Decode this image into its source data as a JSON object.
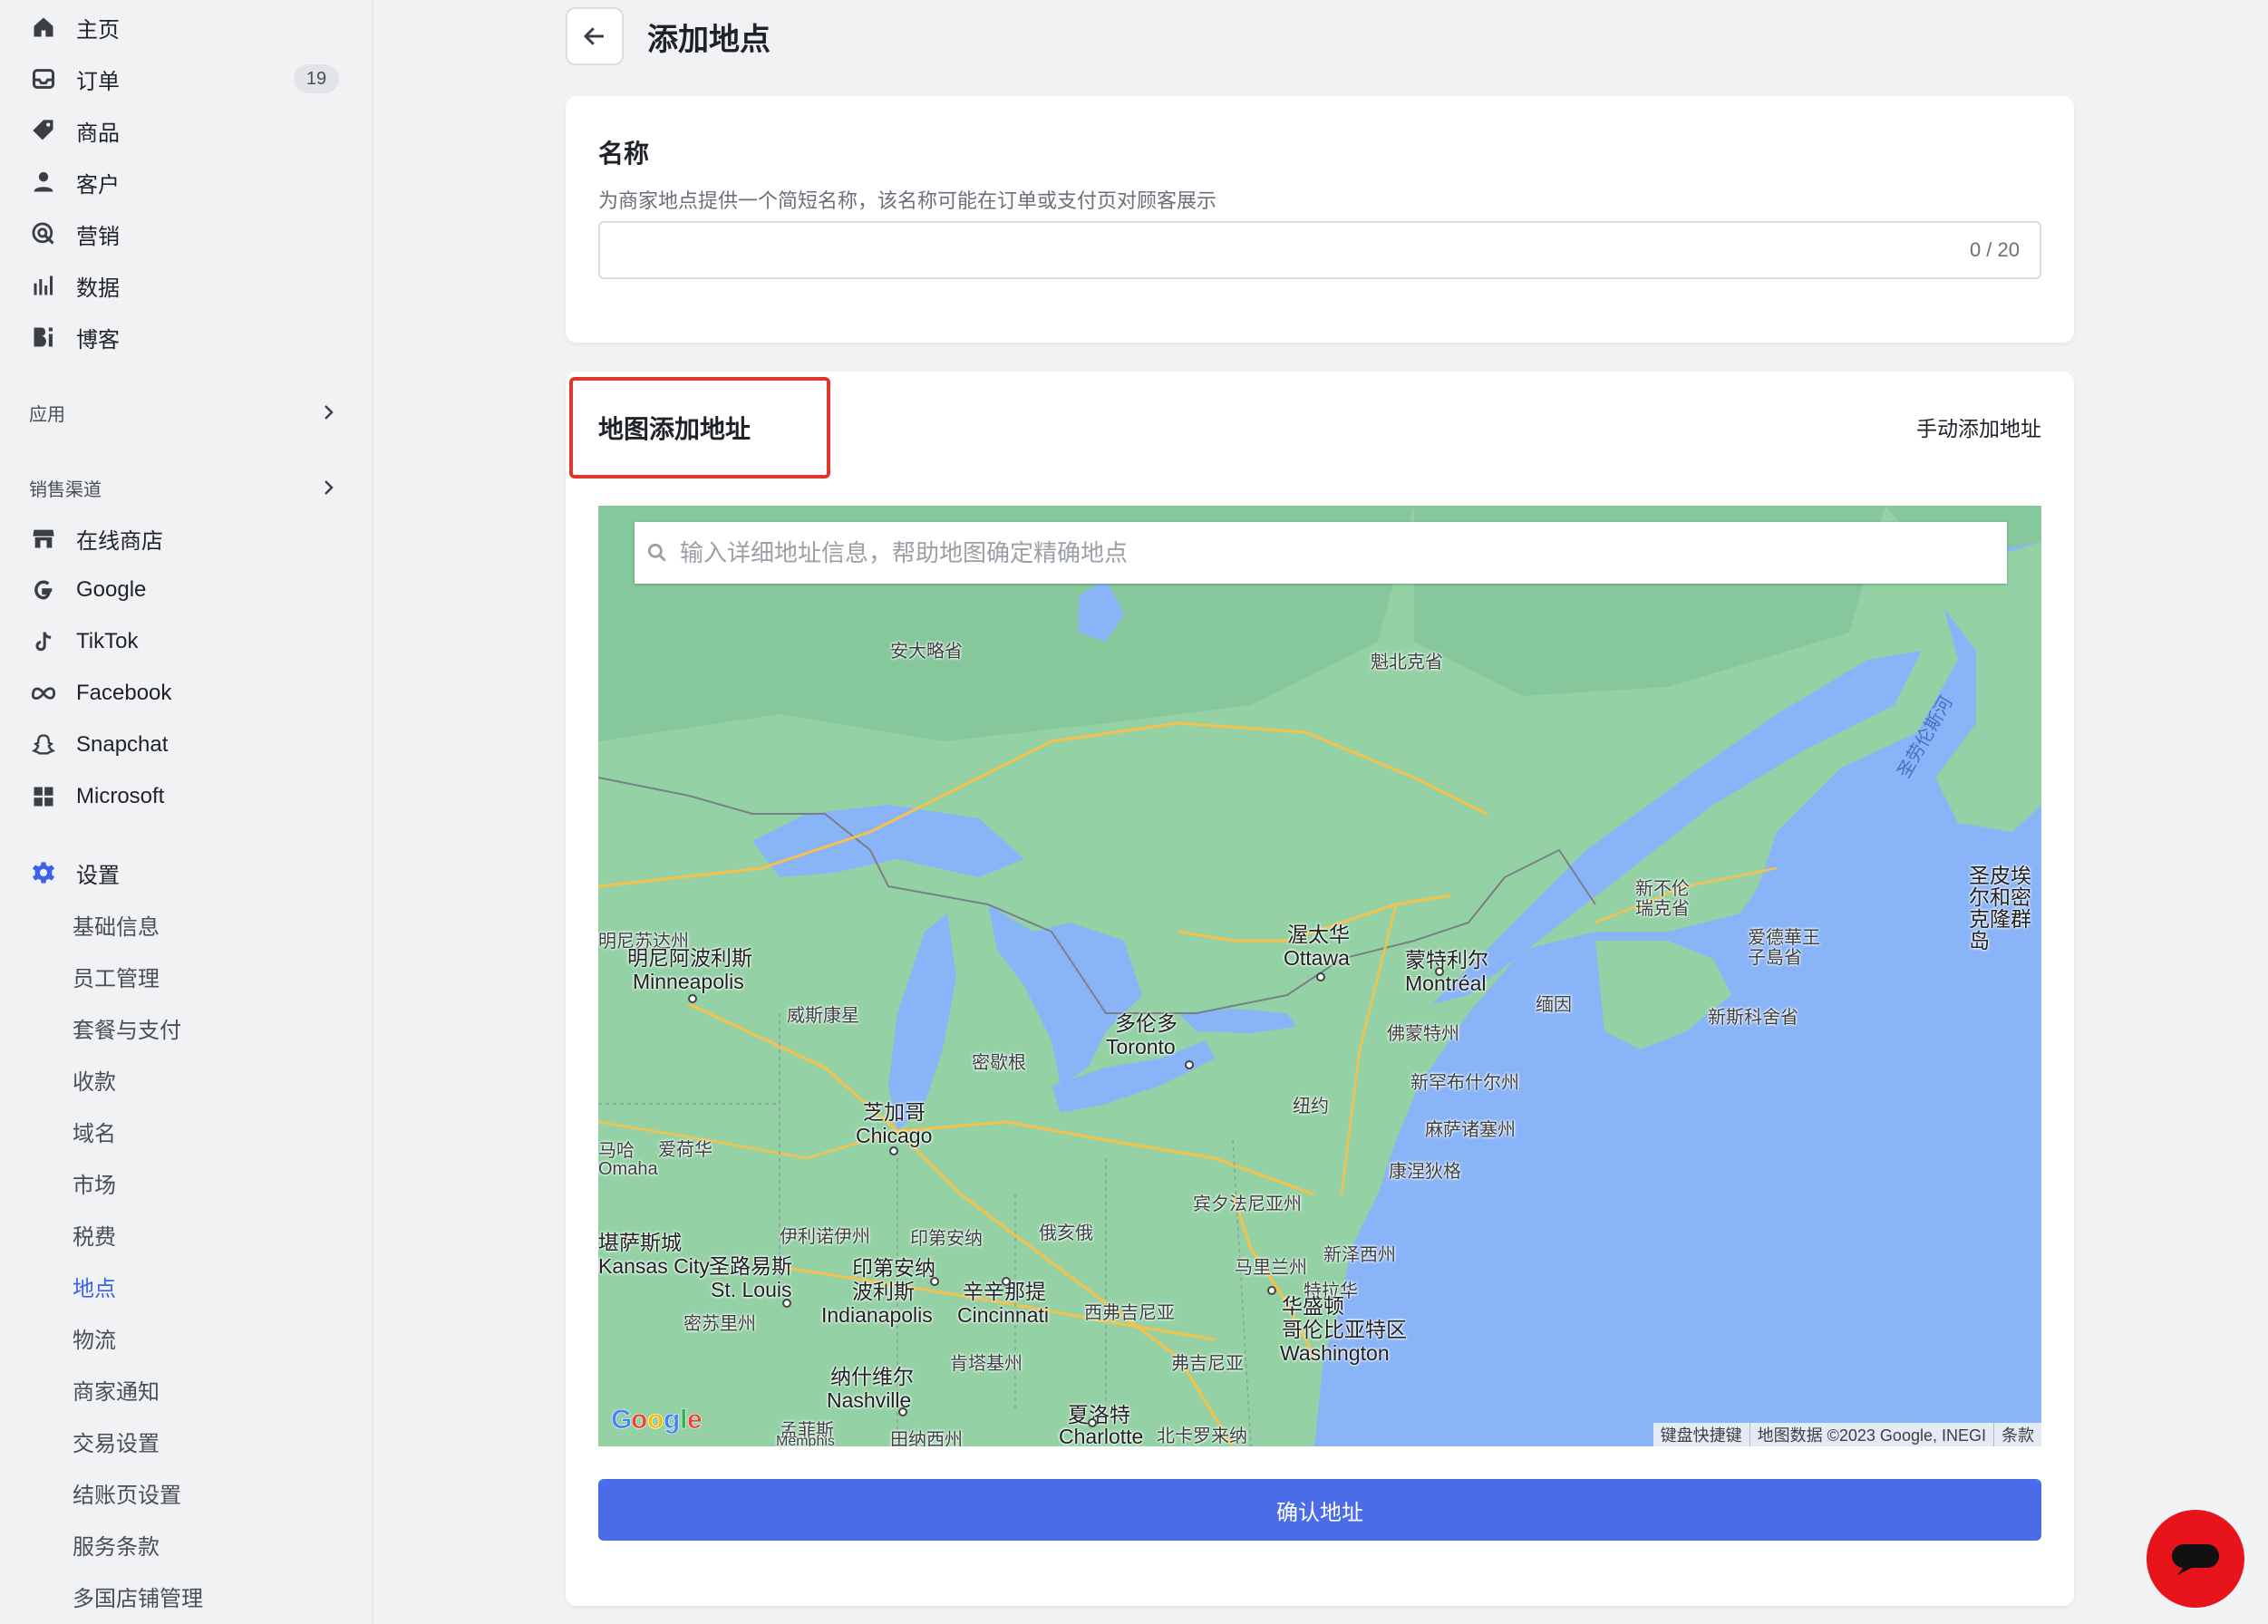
{
  "sidebar": {
    "main": [
      {
        "label": "主页",
        "icon": "home-icon"
      },
      {
        "label": "订单",
        "icon": "inbox-icon",
        "badge": "19"
      },
      {
        "label": "商品",
        "icon": "tag-icon"
      },
      {
        "label": "客户",
        "icon": "person-icon"
      },
      {
        "label": "营销",
        "icon": "target-icon"
      },
      {
        "label": "数据",
        "icon": "bar-chart-icon"
      },
      {
        "label": "博客",
        "icon": "blog-icon"
      }
    ],
    "apps_label": "应用",
    "channels_label": "销售渠道",
    "channels": [
      {
        "label": "在线商店",
        "icon": "store-icon"
      },
      {
        "label": "Google",
        "icon": "google-icon"
      },
      {
        "label": "TikTok",
        "icon": "tiktok-icon"
      },
      {
        "label": "Facebook",
        "icon": "meta-icon"
      },
      {
        "label": "Snapchat",
        "icon": "snapchat-icon"
      },
      {
        "label": "Microsoft",
        "icon": "microsoft-icon"
      }
    ],
    "settings_label": "设置",
    "settings_items": [
      "基础信息",
      "员工管理",
      "套餐与支付",
      "收款",
      "域名",
      "市场",
      "税费",
      "地点",
      "物流",
      "商家通知",
      "交易设置",
      "结账页设置",
      "服务条款",
      "多国店铺管理"
    ],
    "active_item": "地点"
  },
  "header": {
    "title": "添加地点"
  },
  "name_card": {
    "label": "名称",
    "help": "为商家地点提供一个简短名称，该名称可能在订单或支付页对顾客展示",
    "value": "",
    "counter": "0 / 20"
  },
  "map_card": {
    "title": "地图添加地址",
    "manual_link": "手动添加地址",
    "search_placeholder": "输入详细地址信息，帮助地图确定精确地点",
    "confirm_label": "确认地址",
    "labels": {
      "ontario": "安大略省",
      "quebec": "魁北克省",
      "st_lawrence": "圣劳伦斯河",
      "minnesota": "明尼苏达州",
      "minneapolis_cn": "明尼阿波利斯",
      "minneapolis": "Minneapolis",
      "wisconsin": "威斯康星",
      "michigan": "密歇根",
      "ottawa_cn": "渥太华",
      "ottawa": "Ottawa",
      "montreal_cn": "蒙特利尔",
      "montreal": "Montréal",
      "toronto_cn": "多伦多",
      "toronto": "Toronto",
      "new_brunswick": "新不伦瑞克省",
      "pei": "爱德華王子島省",
      "nova_scotia": "新斯科舍省",
      "st_pierre": "圣皮埃尔和密克隆群岛",
      "maine": "缅因",
      "vermont": "佛蒙特州",
      "new_hampshire": "新罕布什尔州",
      "new_york": "纽约",
      "massachusetts": "麻萨诸塞州",
      "connecticut": "康涅狄格",
      "pennsylvania": "宾夕法尼亚州",
      "new_jersey": "新泽西州",
      "maryland": "马里兰州",
      "delaware": "特拉华",
      "washington_cn": "华盛顿",
      "dc_cn": "哥伦比亚特区",
      "washington": "Washington",
      "chicago_cn": "芝加哥",
      "chicago": "Chicago",
      "iowa": "爱荷华",
      "omaha": "马哈\nOmaha",
      "illinois": "伊利诺伊州",
      "indiana": "印第安纳",
      "ohio": "俄亥俄",
      "kansas_city_cn": "堪萨斯城",
      "kansas_city": "Kansas City",
      "st_louis_cn": "圣路易斯",
      "st_louis": "St. Louis",
      "indianapolis_cn": "印第安纳\n波利斯",
      "indianapolis": "Indianapolis",
      "cincinnati_cn": "辛辛那提",
      "cincinnati": "Cincinnati",
      "west_virginia": "西弗吉尼亚",
      "virginia": "弗吉尼亚",
      "missouri": "密苏里州",
      "kentucky": "肯塔基州",
      "nashville_cn": "纳什维尔",
      "nashville": "Nashville",
      "memphis_cn": "孟菲斯",
      "memphis": "Memphis",
      "tennessee": "田纳西州",
      "charlotte_cn": "夏洛特",
      "charlotte": "Charlotte",
      "north_carolina": "北卡罗来纳"
    },
    "footer": [
      "键盘快捷键",
      "地图数据 ©2023 Google, INEGI",
      "条款"
    ]
  },
  "colors": {
    "accent": "#4b6ce8",
    "highlight": "#e0352b",
    "land": "#94d2a5",
    "water": "#8ab4f8"
  }
}
